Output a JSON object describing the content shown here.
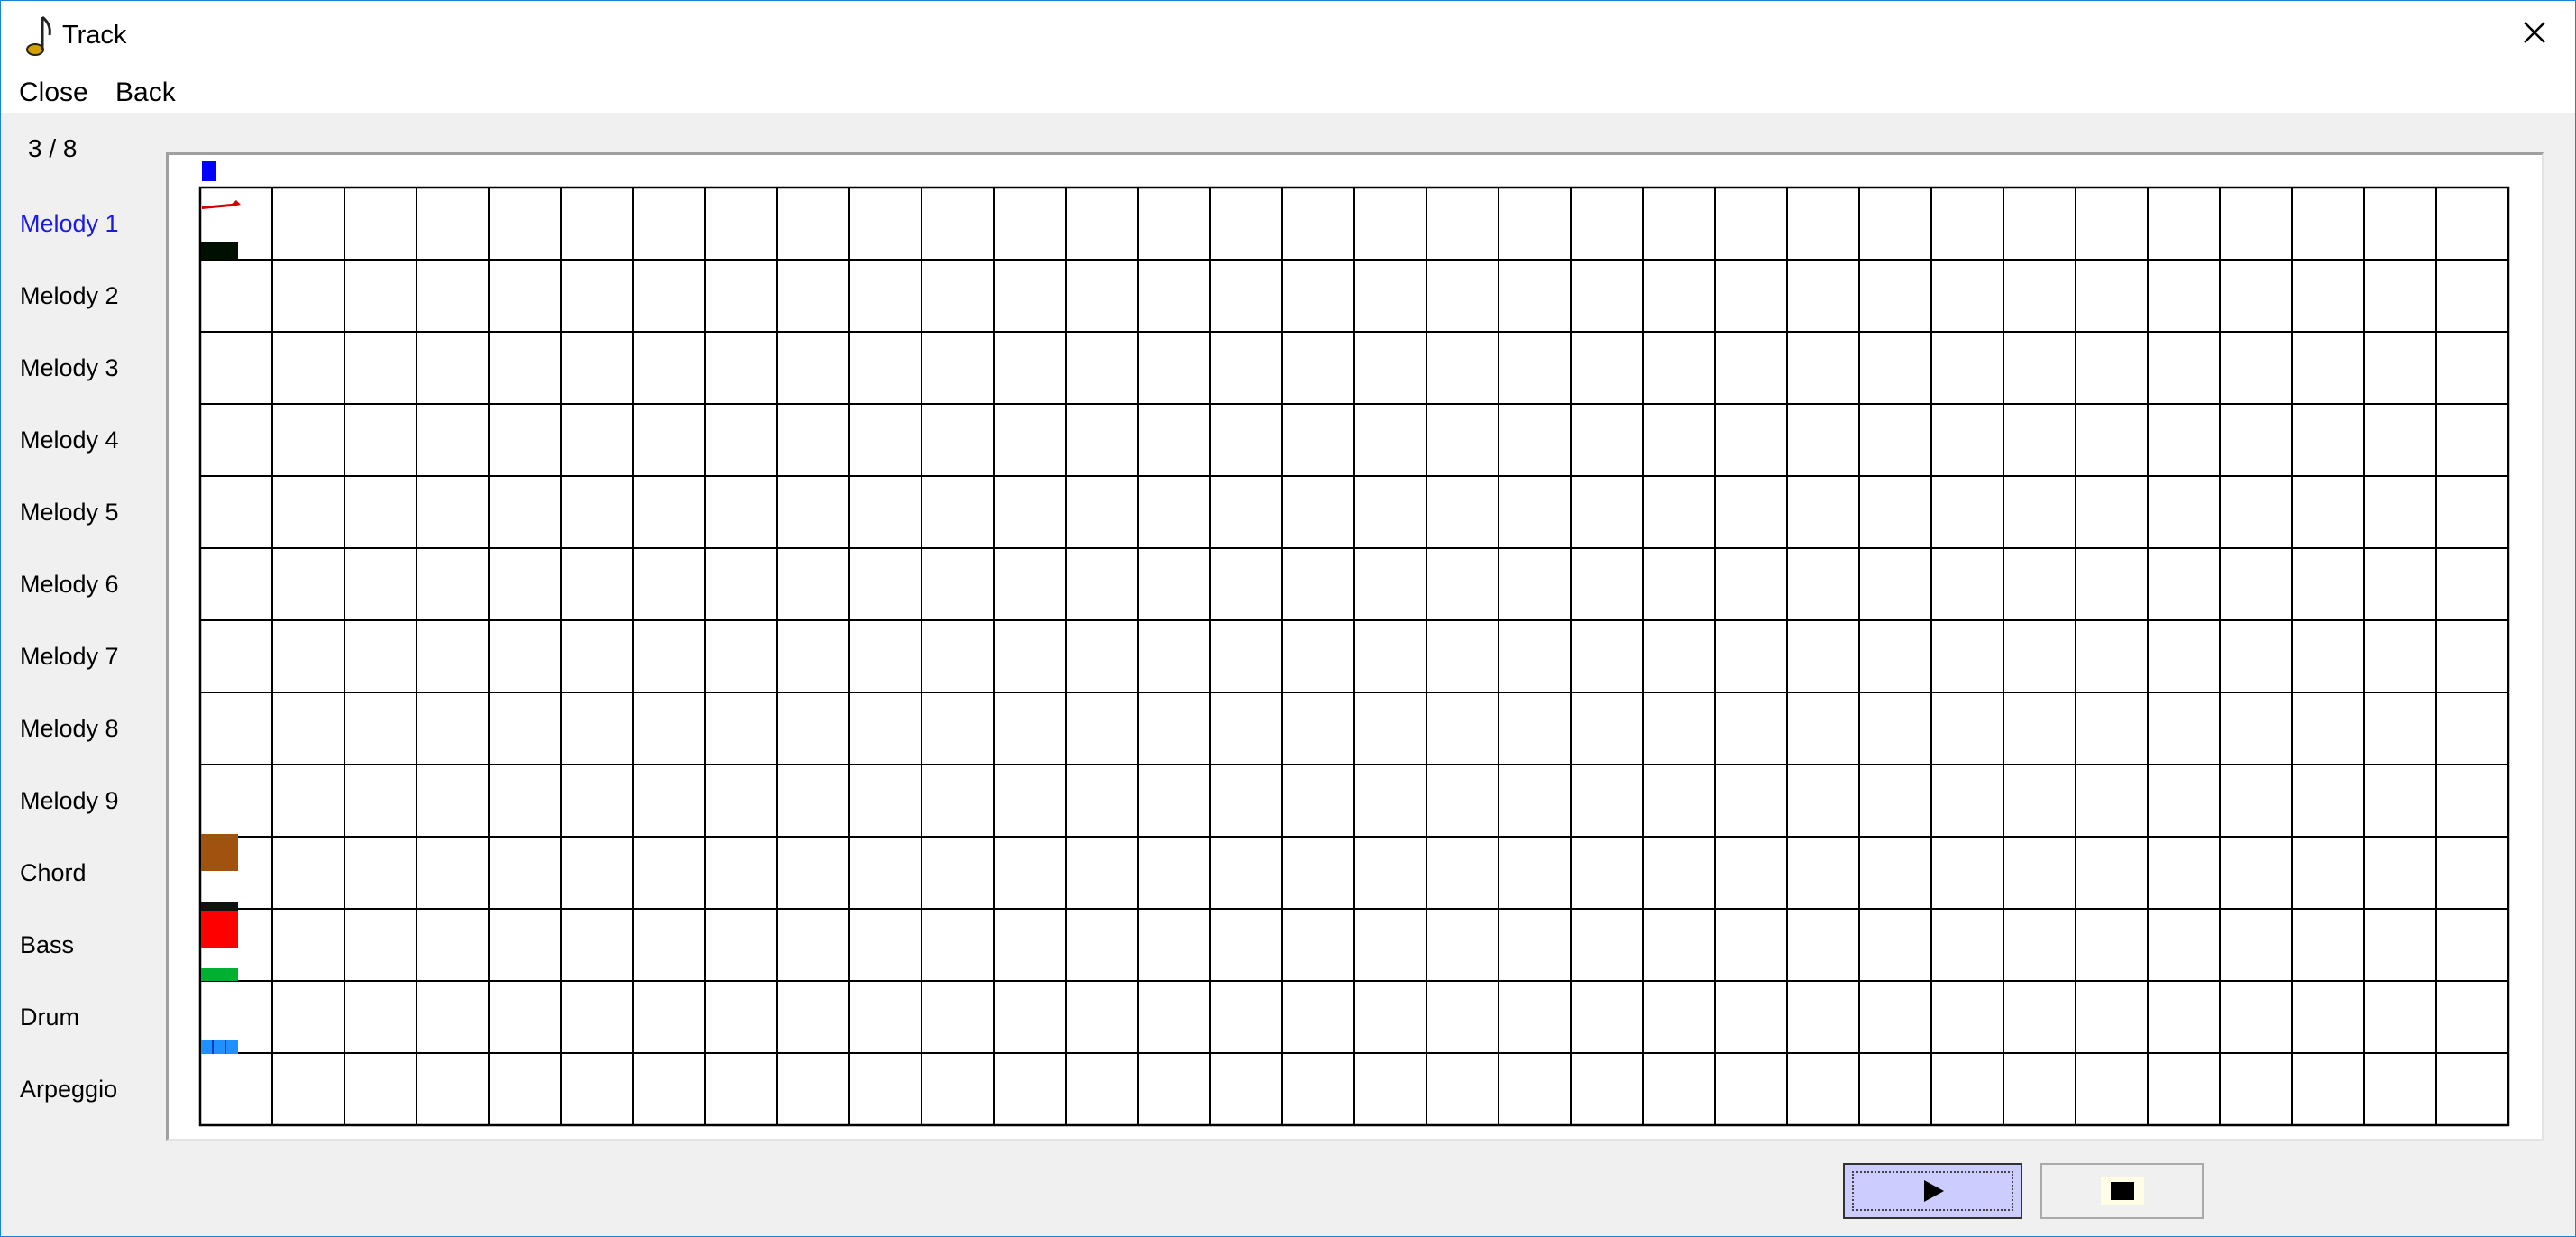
{
  "window": {
    "title": "Track",
    "close_symbol": "×"
  },
  "menu": {
    "close_label": "Close",
    "back_label": "Back"
  },
  "counter": "3 / 8",
  "tracks": [
    {
      "label": "Melody 1",
      "active": true
    },
    {
      "label": "Melody 2"
    },
    {
      "label": "Melody 3"
    },
    {
      "label": "Melody 4"
    },
    {
      "label": "Melody 5"
    },
    {
      "label": "Melody 6"
    },
    {
      "label": "Melody 7"
    },
    {
      "label": "Melody 8"
    },
    {
      "label": "Melody 9"
    },
    {
      "label": "Chord"
    },
    {
      "label": "Bass"
    },
    {
      "label": "Drum"
    },
    {
      "label": "Arpeggio"
    }
  ],
  "grid": {
    "columns": 32,
    "rows": 13
  },
  "colors": {
    "active_track": "#1a1ae6",
    "playhead": "#0000ff",
    "chord_block": "#a0520f",
    "bass_block": "#ff0000",
    "bass_marker": "#00b030",
    "melody_marker": "#001000",
    "drum_marker": "#1e90ff",
    "play_button_bg": "#ccccff"
  },
  "controls": {
    "play_icon": "play-icon",
    "stop_icon": "stop-icon"
  }
}
